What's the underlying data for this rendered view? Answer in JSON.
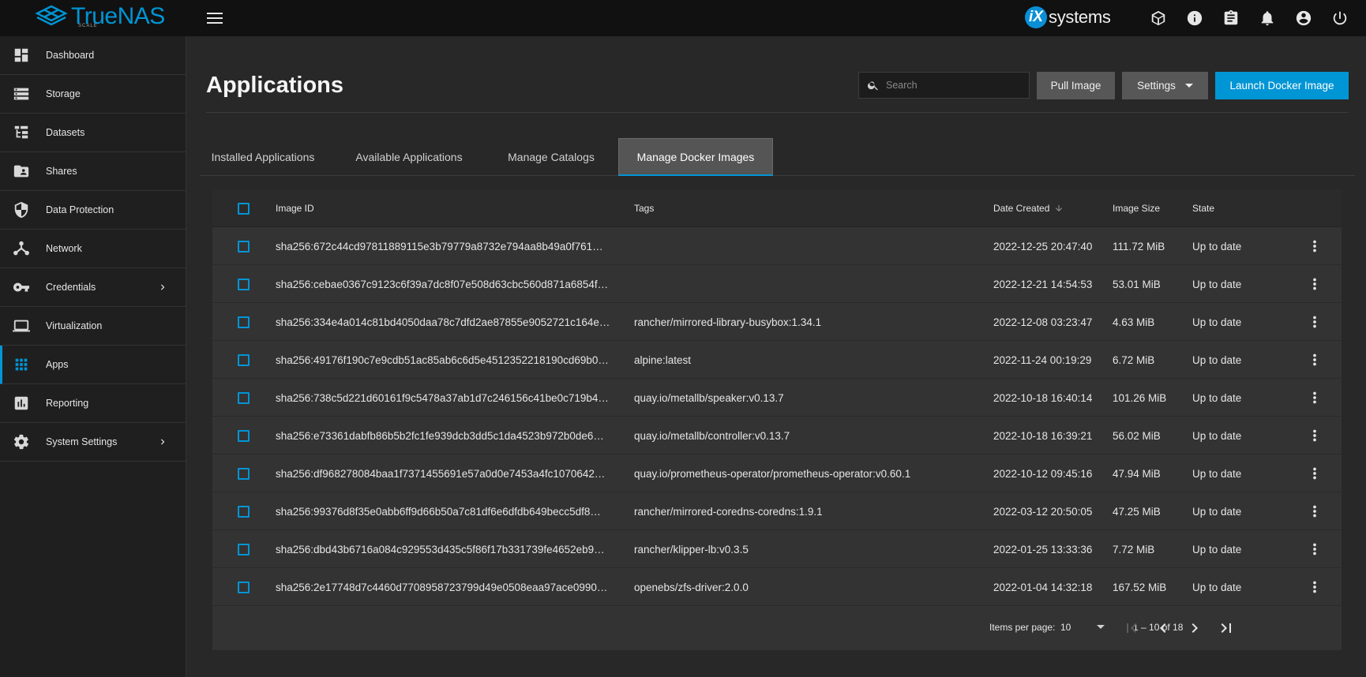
{
  "header": {
    "brand": "TrueNAS",
    "brand_sub": "SCALE",
    "ix_brand": "systems",
    "ix_mark": "iX"
  },
  "sidebar": {
    "items": [
      {
        "label": "Dashboard",
        "icon": "dashboard-icon"
      },
      {
        "label": "Storage",
        "icon": "storage-icon"
      },
      {
        "label": "Datasets",
        "icon": "datasets-icon"
      },
      {
        "label": "Shares",
        "icon": "shares-icon"
      },
      {
        "label": "Data Protection",
        "icon": "shield-icon"
      },
      {
        "label": "Network",
        "icon": "network-icon"
      },
      {
        "label": "Credentials",
        "icon": "key-icon"
      },
      {
        "label": "Virtualization",
        "icon": "laptop-icon"
      },
      {
        "label": "Apps",
        "icon": "apps-grid-icon"
      },
      {
        "label": "Reporting",
        "icon": "chart-icon"
      },
      {
        "label": "System Settings",
        "icon": "gear-icon"
      }
    ]
  },
  "page": {
    "title": "Applications",
    "search_placeholder": "Search",
    "pull_label": "Pull Image",
    "settings_label": "Settings",
    "launch_label": "Launch Docker Image"
  },
  "tabs": [
    {
      "label": "Installed Applications"
    },
    {
      "label": "Available Applications"
    },
    {
      "label": "Manage Catalogs"
    },
    {
      "label": "Manage Docker Images"
    }
  ],
  "table": {
    "columns": {
      "id": "Image ID",
      "tags": "Tags",
      "date": "Date Created",
      "size": "Image Size",
      "state": "State"
    },
    "rows": [
      {
        "id": "sha256:672c44cd97811889115e3b79779a8732e794aa8b49a0f761…",
        "tags": "",
        "date": "2022-12-25 20:47:40",
        "size": "111.72 MiB",
        "state": "Up to date"
      },
      {
        "id": "sha256:cebae0367c9123c6f39a7dc8f07e508d63cbc560d871a6854f…",
        "tags": "",
        "date": "2022-12-21 14:54:53",
        "size": "53.01 MiB",
        "state": "Up to date"
      },
      {
        "id": "sha256:334e4a014c81bd4050daa78c7dfd2ae87855e9052721c164e…",
        "tags": "rancher/mirrored-library-busybox:1.34.1",
        "date": "2022-12-08 03:23:47",
        "size": "4.63 MiB",
        "state": "Up to date"
      },
      {
        "id": "sha256:49176f190c7e9cdb51ac85ab6c6d5e4512352218190cd69b0…",
        "tags": "alpine:latest",
        "date": "2022-11-24 00:19:29",
        "size": "6.72 MiB",
        "state": "Up to date"
      },
      {
        "id": "sha256:738c5d221d60161f9c5478a37ab1d7c246156c41be0c719b4…",
        "tags": "quay.io/metallb/speaker:v0.13.7",
        "date": "2022-10-18 16:40:14",
        "size": "101.26 MiB",
        "state": "Up to date"
      },
      {
        "id": "sha256:e73361dabfb86b5b2fc1fe939dcb3dd5c1da4523b972b0de6…",
        "tags": "quay.io/metallb/controller:v0.13.7",
        "date": "2022-10-18 16:39:21",
        "size": "56.02 MiB",
        "state": "Up to date"
      },
      {
        "id": "sha256:df968278084baa1f7371455691e57a0d0e7453a4fc1070642…",
        "tags": "quay.io/prometheus-operator/prometheus-operator:v0.60.1",
        "date": "2022-10-12 09:45:16",
        "size": "47.94 MiB",
        "state": "Up to date"
      },
      {
        "id": "sha256:99376d8f35e0abb6ff9d66b50a7c81df6e6dfdb649becc5df8…",
        "tags": "rancher/mirrored-coredns-coredns:1.9.1",
        "date": "2022-03-12 20:50:05",
        "size": "47.25 MiB",
        "state": "Up to date"
      },
      {
        "id": "sha256:dbd43b6716a084c929553d435c5f86f17b331739fe4652eb9…",
        "tags": "rancher/klipper-lb:v0.3.5",
        "date": "2022-01-25 13:33:36",
        "size": "7.72 MiB",
        "state": "Up to date"
      },
      {
        "id": "sha256:2e17748d7c4460d7708958723799d49e0508eaa97ace0990…",
        "tags": "openebs/zfs-driver:2.0.0",
        "date": "2022-01-04 14:32:18",
        "size": "167.52 MiB",
        "state": "Up to date"
      }
    ]
  },
  "paginator": {
    "items_label": "Items per page:",
    "page_size": "10",
    "range": "1 – 10 of 18"
  },
  "colors": {
    "accent": "#0095d5",
    "background": "#282828",
    "sidebar": "#1f1f1f",
    "topbar": "#111111"
  }
}
